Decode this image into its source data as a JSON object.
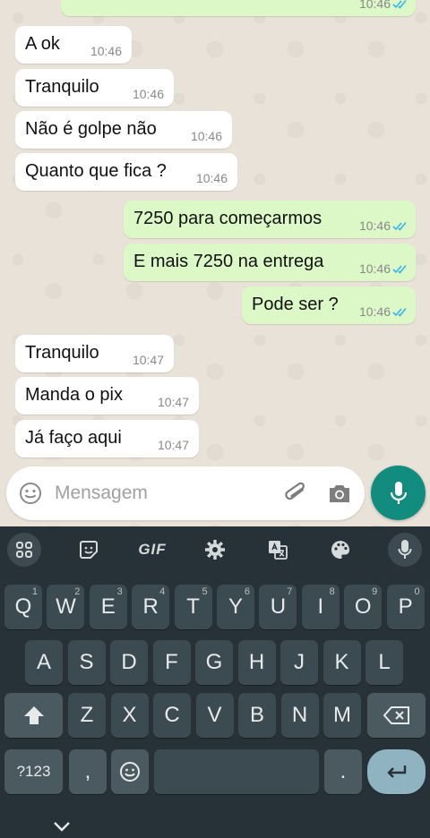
{
  "chat": {
    "top_partial_time": "10:46",
    "messages": [
      {
        "text": "A ok",
        "time": "10:46",
        "dir": "in"
      },
      {
        "text": "Tranquilo",
        "time": "10:46",
        "dir": "in"
      },
      {
        "text": "Não é golpe não",
        "time": "10:46",
        "dir": "in"
      },
      {
        "text": "Quanto que fica ?",
        "time": "10:46",
        "dir": "in"
      },
      {
        "text": "7250 para começarmos",
        "time": "10:46",
        "dir": "out"
      },
      {
        "text": "E mais 7250 na entrega",
        "time": "10:46",
        "dir": "out"
      },
      {
        "text": "Pode ser ?",
        "time": "10:46",
        "dir": "out"
      },
      {
        "text": "Tranquilo",
        "time": "10:47",
        "dir": "in"
      },
      {
        "text": "Manda o pix",
        "time": "10:47",
        "dir": "in"
      },
      {
        "text": "Já faço aqui",
        "time": "10:47",
        "dir": "in"
      }
    ]
  },
  "composer": {
    "placeholder": "Mensagem",
    "emoji_icon": "emoji-icon",
    "attach_icon": "paperclip-icon",
    "camera_icon": "camera-icon",
    "mic_icon": "microphone-icon",
    "fab_color": "#128c7e"
  },
  "keyboard": {
    "toolbar": {
      "apps_icon": "grid-icon",
      "sticker_icon": "sticker-icon",
      "gif_label": "GIF",
      "settings_icon": "gear-icon",
      "translate_icon": "translate-icon",
      "theme_icon": "palette-icon",
      "voice_icon": "microphone-icon"
    },
    "row1": [
      {
        "k": "Q",
        "h": "1"
      },
      {
        "k": "W",
        "h": "2"
      },
      {
        "k": "E",
        "h": "3"
      },
      {
        "k": "R",
        "h": "4"
      },
      {
        "k": "T",
        "h": "5"
      },
      {
        "k": "Y",
        "h": "6"
      },
      {
        "k": "U",
        "h": "7"
      },
      {
        "k": "I",
        "h": "8"
      },
      {
        "k": "O",
        "h": "9"
      },
      {
        "k": "P",
        "h": "0"
      }
    ],
    "row2": [
      "A",
      "S",
      "D",
      "F",
      "G",
      "H",
      "J",
      "K",
      "L"
    ],
    "row3": [
      "Z",
      "X",
      "C",
      "V",
      "B",
      "N",
      "M"
    ],
    "symbols_label": "?123",
    "comma_label": ",",
    "period_label": "."
  }
}
